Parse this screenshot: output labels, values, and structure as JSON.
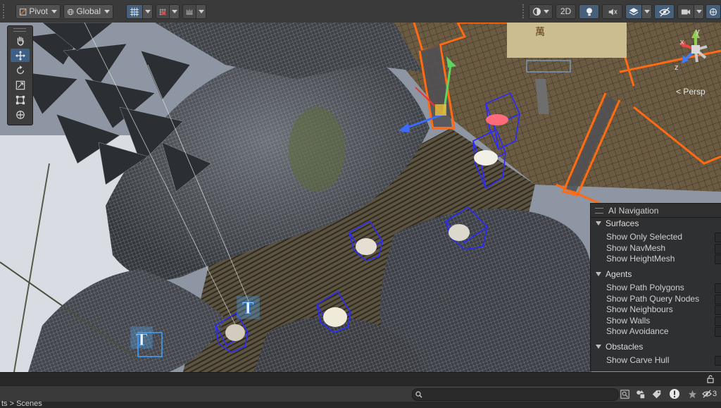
{
  "toolbar": {
    "pivot_label": "Pivot",
    "global_label": "Global",
    "mode_2d_label": "2D"
  },
  "tools": [
    "hand-tool",
    "move-tool",
    "rotate-tool",
    "scale-tool",
    "rect-tool",
    "transform-tool"
  ],
  "gizmo": {
    "axis_y": "y",
    "axis_x": "x",
    "axis_z": "z",
    "projection_label": "< Persp"
  },
  "ai_navigation": {
    "title": "AI Navigation",
    "sections": [
      {
        "label": "Surfaces",
        "items": [
          "Show Only Selected",
          "Show NavMesh",
          "Show HeightMesh"
        ]
      },
      {
        "label": "Agents",
        "items": [
          "Show Path Polygons",
          "Show Path Query Nodes",
          "Show Neighbours",
          "Show Walls",
          "Show Avoidance"
        ]
      },
      {
        "label": "Obstacles",
        "items": [
          "Show Carve Hull"
        ]
      }
    ]
  },
  "bottom": {
    "breadcrumb": "ts > Scenes",
    "count": "3"
  },
  "colors": {
    "selection_orange": "#ff6a13",
    "collider_blue": "#2a2aff",
    "toolbar_bg": "#3a3a3a",
    "active_tool": "#3e5f86"
  }
}
